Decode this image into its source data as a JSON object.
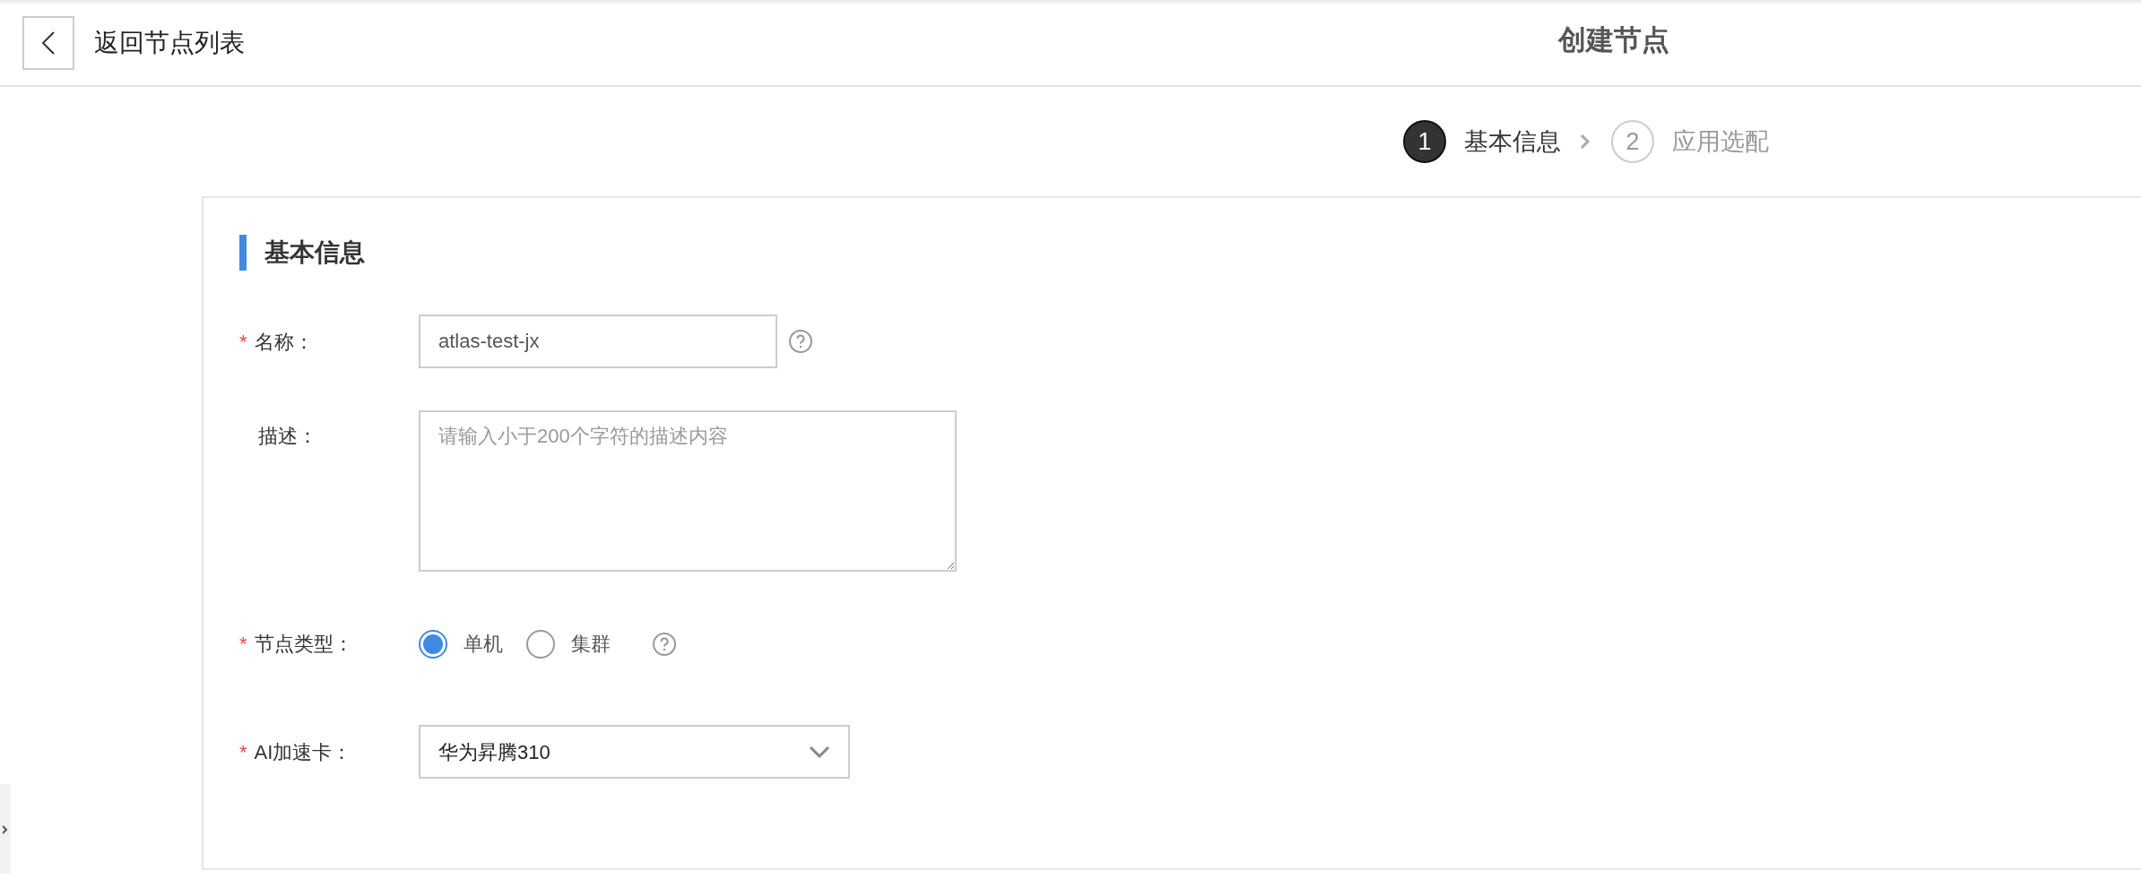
{
  "header": {
    "back_label": "返回节点列表",
    "title": "创建节点"
  },
  "steps": [
    {
      "number": "1",
      "label": "基本信息",
      "selected": true
    },
    {
      "number": "2",
      "label": "应用选配",
      "selected": false
    }
  ],
  "section": {
    "title": "基本信息"
  },
  "fields": [
    {
      "kind": "text",
      "label": "名称：",
      "required_mark": "*",
      "value": "atlas-test-jx",
      "help": true
    },
    {
      "kind": "textarea",
      "label": "描述：",
      "placeholder": "请输入小于200个字符的描述内容",
      "help": false
    },
    {
      "kind": "radio",
      "label": "节点类型：",
      "required_mark": "*",
      "help": true,
      "options": [
        {
          "label": "单机",
          "selected": true
        },
        {
          "label": "集群",
          "selected": false
        }
      ]
    },
    {
      "kind": "select",
      "label": "AI加速卡：",
      "required_mark": "*",
      "value": "华为昇腾310",
      "help": false
    }
  ]
}
